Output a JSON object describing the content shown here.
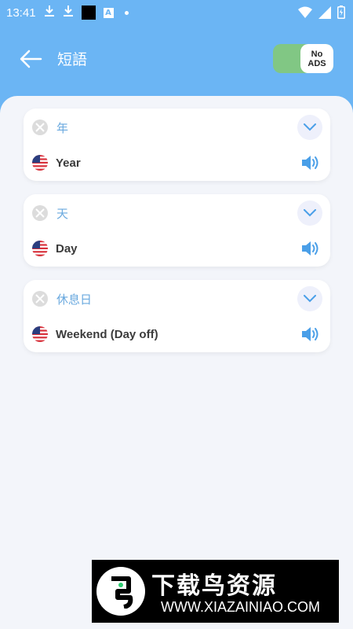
{
  "status_bar": {
    "time": "13:41"
  },
  "header": {
    "title": "短語",
    "no_ads_line1": "No",
    "no_ads_line2": "ADS"
  },
  "phrases": [
    {
      "native": "年",
      "english": "Year"
    },
    {
      "native": "天",
      "english": "Day"
    },
    {
      "native": "休息日",
      "english": "Weekend (Day off)"
    }
  ],
  "watermark": {
    "title": "下载鸟资源",
    "url": "WWW.XIAZAINIAO.COM"
  },
  "colors": {
    "header_bg": "#6bb5f4",
    "content_bg": "#f3f5fa",
    "accent_blue": "#4a9fe8",
    "native_text": "#6aa9df",
    "toggle_green": "#81c784"
  }
}
